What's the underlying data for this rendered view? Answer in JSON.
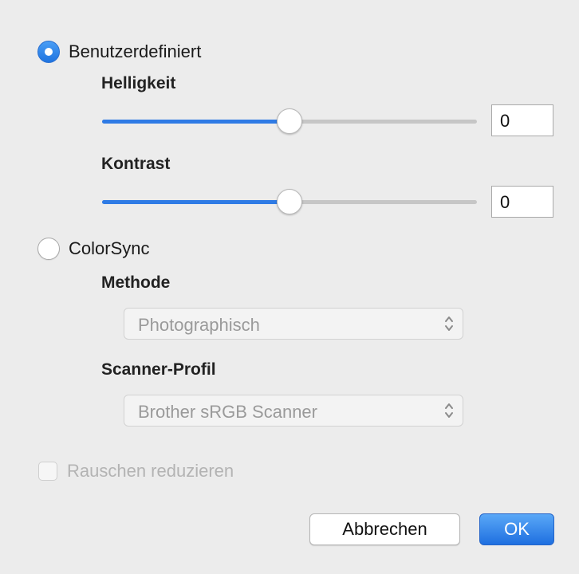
{
  "custom": {
    "label": "Benutzerdefiniert",
    "selected": true,
    "brightness": {
      "label": "Helligkeit",
      "value": "0",
      "slider_level": 0.5
    },
    "contrast": {
      "label": "Kontrast",
      "value": "0",
      "slider_level": 0.5
    }
  },
  "colorsync": {
    "label": "ColorSync",
    "selected": false,
    "method": {
      "label": "Methode",
      "selected": "Photographisch"
    },
    "scanner_profile": {
      "label": "Scanner-Profil",
      "selected": "Brother sRGB Scanner"
    }
  },
  "noise_reduction": {
    "label": "Rauschen reduzieren",
    "checked": false,
    "enabled": false
  },
  "buttons": {
    "cancel": "Abbrechen",
    "ok": "OK"
  },
  "colors": {
    "accent": "#2f7be5",
    "disabled_text": "#b3b3b3"
  },
  "icons": {
    "select_arrows": "chevron-up-down-icon"
  }
}
